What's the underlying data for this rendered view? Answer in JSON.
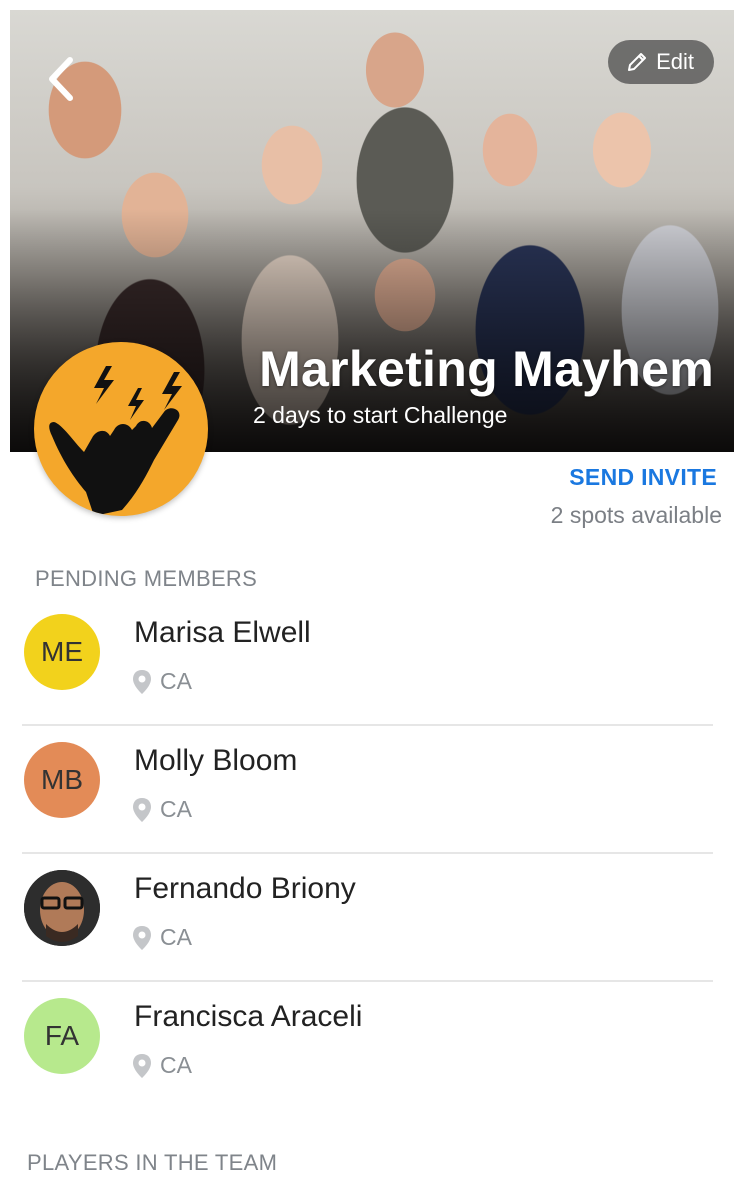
{
  "hero": {
    "title": "Marketing Mayhem",
    "subtitle": "2 days to start Challenge",
    "edit_label": "Edit"
  },
  "invite": {
    "label": "SEND INVITE",
    "spots": "2 spots available"
  },
  "sections": {
    "pending": "PENDING MEMBERS",
    "players": "PLAYERS IN THE TEAM"
  },
  "members": [
    {
      "initials": "ME",
      "name": "Marisa Elwell",
      "location": "CA",
      "color": "#f2d21c"
    },
    {
      "initials": "MB",
      "name": "Molly Bloom",
      "location": "CA",
      "color": "#e38b57"
    },
    {
      "initials": "",
      "name": "Fernando Briony",
      "location": "CA",
      "color": "#2a2a2a"
    },
    {
      "initials": "FA",
      "name": "Francisca Araceli",
      "location": "CA",
      "color": "#b7e98d"
    }
  ],
  "colors": {
    "accent": "#1a78e0",
    "team_avatar": "#f4a72b"
  },
  "icons": [
    "back-arrow-icon",
    "pencil-icon",
    "location-pin-icon",
    "rock-hand-icon"
  ]
}
